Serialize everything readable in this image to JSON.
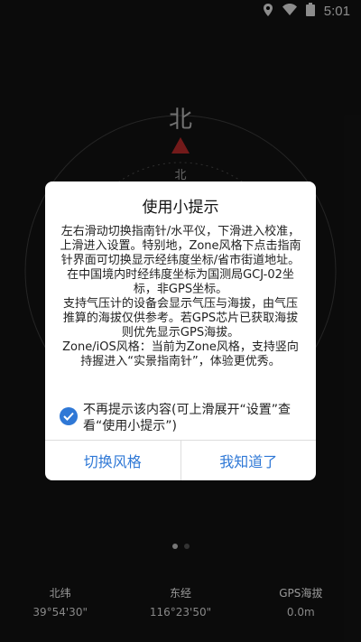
{
  "status_bar": {
    "time": "5:01",
    "icons": [
      "location-icon",
      "wifi-icon",
      "battery-icon"
    ]
  },
  "compass": {
    "north_big": "北",
    "north_small": "北",
    "pointer_color": "#d23030"
  },
  "dialog": {
    "title": "使用小提示",
    "paragraphs": [
      "左右滑动切换指南针/水平仪，下滑进入校准，上滑进入设置。特别地，Zone风格下点击指南针界面可切换显示经纬度坐标/省市街道地址。",
      "在中国境内时经纬度坐标为国测局GCJ-02坐标，非GPS坐标。",
      "支持气压计的设备会显示气压与海拔，由气压推算的海拔仅供参考。若GPS芯片已获取海拔则优先显示GPS海拔。",
      "Zone/iOS风格：当前为Zone风格，支持竖向持握进入“实景指南针”，体验更优秀。"
    ],
    "checkbox_label": "不再提示该内容(可上滑展开“设置”查看“使用小提示”)",
    "checkbox_checked": true,
    "buttons": {
      "switch_style": "切换风格",
      "got_it": "我知道了"
    },
    "accent": "#2f78d6"
  },
  "pager": {
    "active": 1,
    "count": 2
  },
  "bottom_info": {
    "latitude": {
      "label": "北纬",
      "value": "39°54'30\""
    },
    "longitude": {
      "label": "东经",
      "value": "116°23'50\""
    },
    "altitude": {
      "label": "GPS海拔",
      "value": "0.0m"
    }
  }
}
